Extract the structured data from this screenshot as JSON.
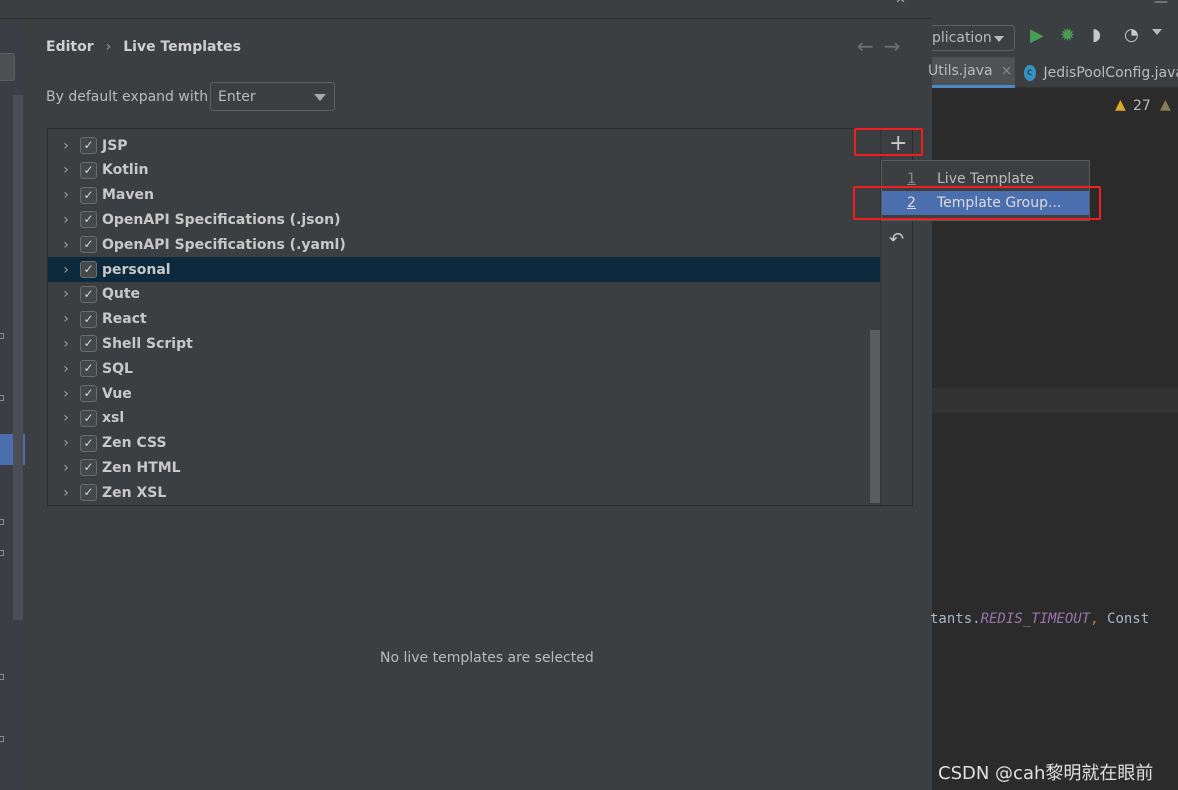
{
  "dialog": {
    "breadcrumb": [
      "Editor",
      "Live Templates"
    ],
    "expand_label": "By default expand with",
    "expand_value": "Enter",
    "groups": [
      {
        "label": "JSP",
        "checked": true
      },
      {
        "label": "Kotlin",
        "checked": true
      },
      {
        "label": "Maven",
        "checked": true
      },
      {
        "label": "OpenAPI Specifications (.json)",
        "checked": true
      },
      {
        "label": "OpenAPI Specifications (.yaml)",
        "checked": true
      },
      {
        "label": "personal",
        "checked": true,
        "selected": true
      },
      {
        "label": "Qute",
        "checked": true
      },
      {
        "label": "React",
        "checked": true
      },
      {
        "label": "Shell Script",
        "checked": true
      },
      {
        "label": "SQL",
        "checked": true
      },
      {
        "label": "Vue",
        "checked": true
      },
      {
        "label": "xsl",
        "checked": true
      },
      {
        "label": "Zen CSS",
        "checked": true
      },
      {
        "label": "Zen HTML",
        "checked": true
      },
      {
        "label": "Zen XSL",
        "checked": true
      }
    ],
    "empty_message": "No live templates are selected",
    "add_menu": [
      {
        "num": "1",
        "label": "Live Template"
      },
      {
        "num": "2",
        "label": "Template Group...",
        "highlighted": true
      }
    ]
  },
  "ide": {
    "run_config": "plication",
    "tabs": [
      {
        "label": "Utils.java"
      },
      {
        "label": "JedisPoolConfig.java"
      }
    ],
    "warning_count": "27",
    "code": {
      "prefix": "tants.",
      "constant": "REDIS_TIMEOUT",
      "comma": ",",
      "suffix": " Const"
    }
  },
  "watermark": "CSDN @cah黎明就在眼前",
  "colors": {
    "selection": "#4b6eaf",
    "tree_selected": "#0d293e",
    "highlight_box": "#f01e1e"
  }
}
